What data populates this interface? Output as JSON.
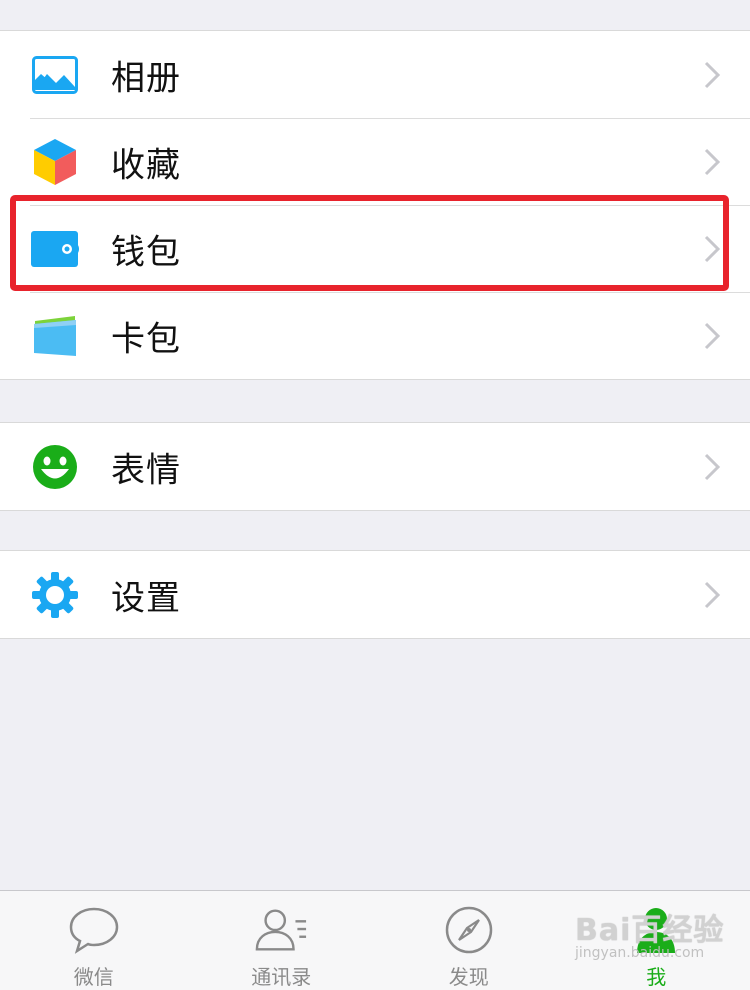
{
  "groups": [
    {
      "items": [
        {
          "label": "相册",
          "icon": "photo-album-icon"
        },
        {
          "label": "收藏",
          "icon": "favorites-cube-icon"
        },
        {
          "label": "钱包",
          "icon": "wallet-icon"
        },
        {
          "label": "卡包",
          "icon": "card-wallet-icon"
        }
      ]
    },
    {
      "items": [
        {
          "label": "表情",
          "icon": "smiley-icon"
        }
      ]
    },
    {
      "items": [
        {
          "label": "设置",
          "icon": "gear-icon"
        }
      ]
    }
  ],
  "tabbar": {
    "tabs": [
      {
        "label": "微信",
        "icon": "chat-bubble-icon",
        "active": false
      },
      {
        "label": "通讯录",
        "icon": "contacts-icon",
        "active": false
      },
      {
        "label": "发现",
        "icon": "compass-icon",
        "active": false
      },
      {
        "label": "我",
        "icon": "me-person-icon",
        "active": true
      }
    ]
  },
  "watermark": {
    "main": "Bai百经验",
    "sub": "jingyan.baidu.com"
  },
  "colors": {
    "background": "#efeff4",
    "accent_green": "#1aad19",
    "highlight_red": "#e8232c",
    "icon_blue": "#1aa7f2"
  }
}
